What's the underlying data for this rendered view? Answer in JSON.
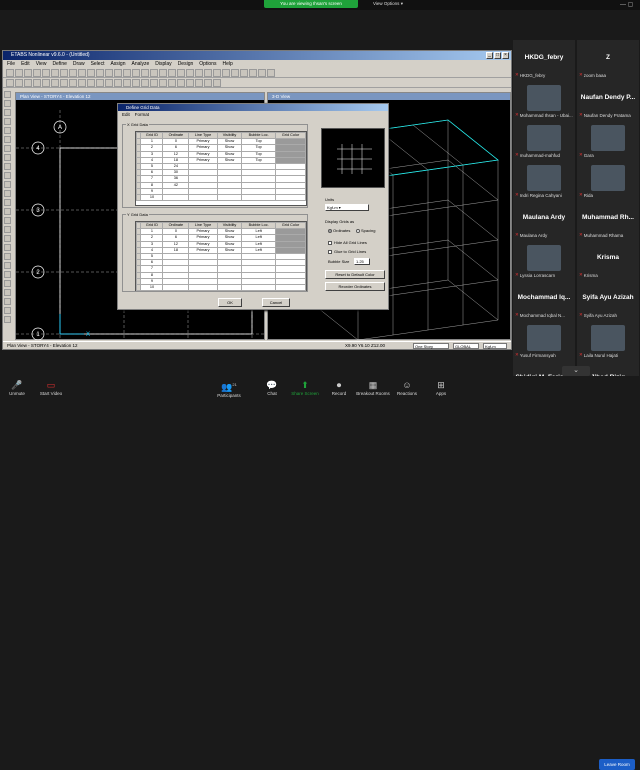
{
  "zoom": {
    "share_banner": "You are viewing Ihsan's screen",
    "view_options": "View Options",
    "controls": [
      "Unmute",
      "Start Video",
      "Participants",
      "Chat",
      "Share Screen",
      "Record",
      "Breakout Rooms",
      "Reactions",
      "Apps"
    ],
    "participant_count": "21",
    "leave": "Leave Room"
  },
  "etabs": {
    "title": "ETABS Nonlinear v9.6.0 - (Untitled)",
    "menu": [
      "File",
      "Edit",
      "View",
      "Define",
      "Draw",
      "Select",
      "Assign",
      "Analyze",
      "Display",
      "Design",
      "Options",
      "Help"
    ],
    "plan_title": "Plan View - STORY4 - Elevation 12",
    "view3d_title": "3-D View",
    "status_left": "Plan View - STORY4 - Elevation 12",
    "status_coords": "X9.90 Y6.10 Z12.00",
    "status_story": "One Story",
    "status_global": "GLOBAL",
    "status_units": "Kgf-m",
    "grid_labels": [
      "4",
      "3",
      "2",
      "1",
      "A",
      "B",
      "C"
    ]
  },
  "dialog": {
    "title": "Define Grid Data",
    "menu": [
      "Edit",
      "Format"
    ],
    "x_label": "X Grid Data",
    "y_label": "Y Grid Data",
    "headers": [
      "Grid ID",
      "Ordinate",
      "Line Type",
      "Visibility",
      "Bubble Loc.",
      "Grid Color"
    ],
    "x_rows": [
      [
        "1",
        "0",
        "Primary",
        "Show",
        "Top"
      ],
      [
        "2",
        "6",
        "Primary",
        "Show",
        "Top"
      ],
      [
        "3",
        "12",
        "Primary",
        "Show",
        "Top"
      ],
      [
        "4",
        "18",
        "Primary",
        "Show",
        "Top"
      ],
      [
        "5",
        "24",
        "",
        "",
        ""
      ],
      [
        "6",
        "30",
        "",
        "",
        ""
      ],
      [
        "7",
        "36",
        "",
        "",
        ""
      ],
      [
        "8",
        "42",
        "",
        "",
        ""
      ],
      [
        "9",
        "",
        "",
        "",
        ""
      ],
      [
        "10",
        "",
        "",
        "",
        ""
      ]
    ],
    "y_rows": [
      [
        "1",
        "0",
        "Primary",
        "Show",
        "Left"
      ],
      [
        "2",
        "6",
        "Primary",
        "Show",
        "Left"
      ],
      [
        "3",
        "12",
        "Primary",
        "Show",
        "Left"
      ],
      [
        "4",
        "18",
        "Primary",
        "Show",
        "Left"
      ],
      [
        "5",
        "",
        "",
        "",
        ""
      ],
      [
        "6",
        "",
        "",
        "",
        ""
      ],
      [
        "7",
        "",
        "",
        "",
        ""
      ],
      [
        "8",
        "",
        "",
        "",
        ""
      ],
      [
        "9",
        "",
        "",
        "",
        ""
      ],
      [
        "10",
        "",
        "",
        "",
        ""
      ]
    ],
    "units_label": "Units",
    "units_value": "Kgf-m",
    "display_label": "Display Grids as",
    "ordinates": "Ordinates",
    "spacing": "Spacing",
    "hide_all": "Hide All Grid Lines",
    "glue": "Glue to Grid Lines",
    "bubble_label": "Bubble Size",
    "bubble_value": "1.25",
    "reset_color": "Reset to Default Color",
    "reorder": "Reorder Ordinates",
    "ok": "OK",
    "cancel": "Cancel"
  },
  "gallery": [
    {
      "big": "HKDG_febry",
      "name": "HKDG_febry"
    },
    {
      "big": "Z",
      "name": "zoom baaa"
    },
    {
      "big": "",
      "name": "Mohammad Ihsan - Ubai..."
    },
    {
      "big": "Naufan Dendy P...",
      "name": "Naufan Dendy Pratama"
    },
    {
      "big": "",
      "name": "muhammad-mahfud"
    },
    {
      "big": "",
      "name": "Gara"
    },
    {
      "big": "",
      "name": "Indri Regina Cahyani"
    },
    {
      "big": "",
      "name": "Rida"
    },
    {
      "big": "Maulana Ardy",
      "name": "Maulana Ardy"
    },
    {
      "big": "Muhammad Rh...",
      "name": "Muhammad Rhama"
    },
    {
      "big": "",
      "name": "Lyssia Lorrascarn"
    },
    {
      "big": "Krisma",
      "name": "Krisma"
    },
    {
      "big": "Mochammad Iq...",
      "name": "Mochammad Iqbal N..."
    },
    {
      "big": "Syifa Ayu Azizah",
      "name": "Syifa Ayu Azizah"
    },
    {
      "big": "",
      "name": "Yusuf Firmansyah"
    },
    {
      "big": "",
      "name": "Laila Nurul Hajati"
    },
    {
      "big": "Shidiqi M. Farisa...",
      "name": "Shidiqi M. Farisan Fag..."
    },
    {
      "big": "Jihad Riziq",
      "name": "Jihad Riziq"
    }
  ]
}
